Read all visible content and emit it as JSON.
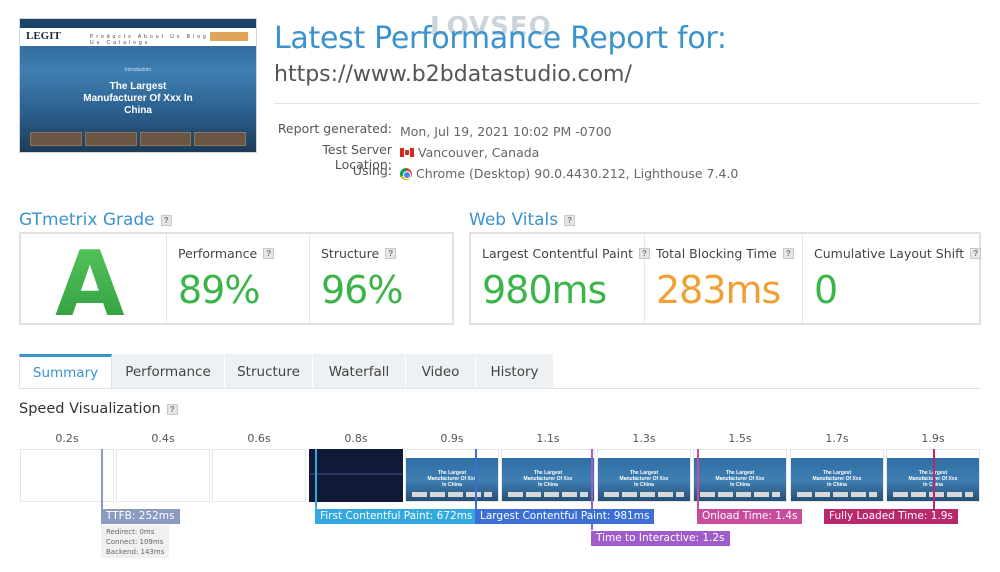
{
  "report": {
    "title": "Latest Performance Report for:",
    "url": "https://www.b2bdatastudio.com/",
    "watermark": "LOVSEO",
    "meta": [
      {
        "key": "Report generated:",
        "value": "Mon, Jul 19, 2021 10:02 PM -0700"
      },
      {
        "key": "Test Server Location:",
        "value": "Vancouver, Canada",
        "icon": "canada-flag-icon"
      },
      {
        "key": "Using:",
        "value": "Chrome (Desktop) 90.0.4430.212, Lighthouse 7.4.0",
        "icon": "chrome-icon"
      }
    ]
  },
  "thumbnail": {
    "logo": "LEGIT",
    "nav_links": "Products  About Us  Blog  Contact Us  Catalogs",
    "tagline": "Introduction",
    "hero": "The Largest Manufacturer Of Xxx In China"
  },
  "grade": {
    "heading": "GTmetrix Grade",
    "letter": "A",
    "performance": {
      "label": "Performance",
      "value": "89%"
    },
    "structure": {
      "label": "Structure",
      "value": "96%"
    }
  },
  "vitals": {
    "heading": "Web Vitals",
    "lcp": {
      "label": "Largest Contentful Paint",
      "value": "980ms"
    },
    "tbt": {
      "label": "Total Blocking Time",
      "value": "283ms"
    },
    "cls": {
      "label": "Cumulative Layout Shift",
      "value": "0"
    }
  },
  "tabs": [
    "Summary",
    "Performance",
    "Structure",
    "Waterfall",
    "Video",
    "History"
  ],
  "speed": {
    "heading": "Speed Visualization",
    "times": [
      "0.2s",
      "0.4s",
      "0.6s",
      "0.8s",
      "0.9s",
      "1.1s",
      "1.3s",
      "1.5s",
      "1.7s",
      "1.9s"
    ],
    "frame_text": "The Largest Manufacturer Of Xxx In China",
    "markers": {
      "ttfb": "TTFB: 252ms",
      "ttfb_detail": [
        "Redirect: 0ms",
        "Connect: 109ms",
        "Backend: 143ms"
      ],
      "fcp": "First Contentful Paint: 672ms",
      "lcp": "Largest Contentful Paint: 981ms",
      "tti": "Time to Interactive: 1.2s",
      "onload": "Onload Time: 1.4s",
      "fully": "Fully Loaded Time: 1.9s"
    }
  },
  "colors": {
    "accent": "#3a92cf",
    "good": "#3bb54a",
    "warn": "#f0a033",
    "ttfb": "#8b9bbf",
    "fcp": "#33a9e0",
    "lcp": "#3b6fd6",
    "tti": "#a05cc9",
    "onload": "#c84c9c",
    "fully": "#b8286b"
  }
}
